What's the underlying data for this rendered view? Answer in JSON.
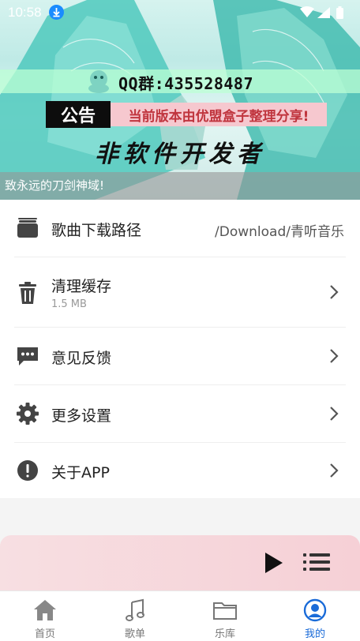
{
  "status_bar": {
    "time": "10:58"
  },
  "banner": {
    "qq_group": "QQ群:435528487",
    "notice_label": "公告",
    "notice_text": "当前版本由优盟盒子整理分享!",
    "developer_text": "非软件开发者",
    "marquee_text": "致永远的刀剑神域!"
  },
  "settings": [
    {
      "label": "歌曲下载路径",
      "value": "/Download/青听音乐",
      "icon": "folder-icon"
    },
    {
      "label": "清理缓存",
      "sub": "1.5 MB",
      "icon": "trash-icon"
    },
    {
      "label": "意见反馈",
      "icon": "feedback-icon"
    },
    {
      "label": "更多设置",
      "icon": "gear-icon"
    },
    {
      "label": "关于APP",
      "icon": "info-icon"
    }
  ],
  "tabs": [
    {
      "label": "首页",
      "icon": "home-icon"
    },
    {
      "label": "歌单",
      "icon": "music-note-icon"
    },
    {
      "label": "乐库",
      "icon": "folder-icon"
    },
    {
      "label": "我的",
      "icon": "user-icon",
      "active": true
    }
  ],
  "colors": {
    "accent": "#1a6bd8",
    "player_bg": "#f6d0d6"
  }
}
